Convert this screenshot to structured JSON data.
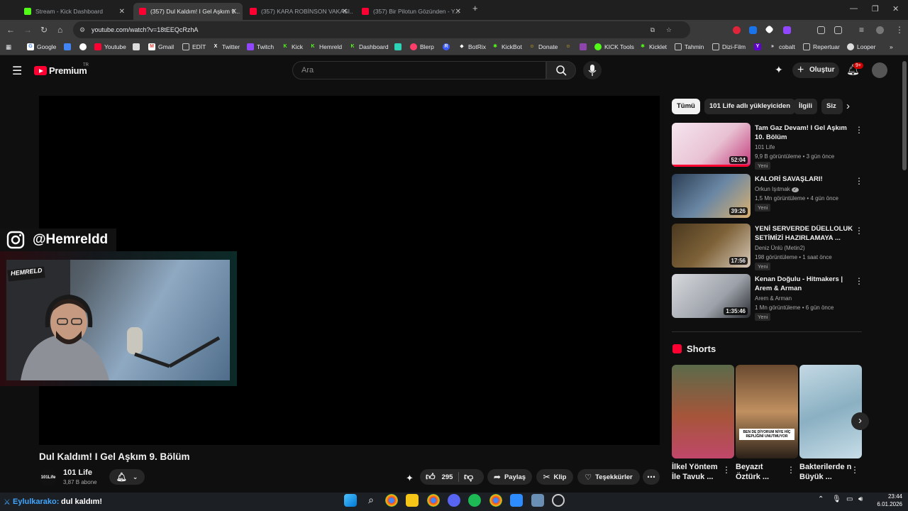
{
  "browser": {
    "tabs": [
      {
        "label": "Stream - Kick Dashboard",
        "active": false
      },
      {
        "label": "(357) Dul Kaldım! I Gel Aşkım 9...",
        "active": true
      },
      {
        "label": "(357) KARA ROBİNSON VAKASI...",
        "active": false
      },
      {
        "label": "(357) Bir Pilotun Gözünden - Y...",
        "active": false
      }
    ],
    "url": "youtube.com/watch?v=18tEEQcRzhA",
    "bookmarks": [
      "Google",
      "Youtube",
      "Gmail",
      "EDİT",
      "Twitter",
      "Twitch",
      "Kick",
      "Hemreld",
      "Dashboard",
      "Blerp",
      "BotRix",
      "KickBot",
      "Donate",
      "KICK Tools",
      "Kicklet",
      "Tahmin",
      "Dizi-Film",
      "cobalt",
      "Repertuar",
      "Looper"
    ]
  },
  "masthead": {
    "logo_text": "Premium",
    "logo_region": "TR",
    "search_placeholder": "Ara",
    "create_label": "Oluştur",
    "notif_count": "9+"
  },
  "overlay": {
    "ig_handle": "@Hemreldd",
    "cam_logo": "HEMRELD"
  },
  "video": {
    "title": "Dul Kaldım! I Gel Aşkım 9. Bölüm",
    "channel": "101 Life",
    "subscribers": "3,87 B abone",
    "avatar_text": "101Life",
    "likes": "295",
    "share_label": "Paylaş",
    "clip_label": "Klip",
    "thanks_label": "Teşekkürler"
  },
  "chips": [
    "Tümü",
    "101 Life adlı yükleyiciden",
    "İlgili",
    "Siz"
  ],
  "recommendations": [
    {
      "title": "Tam Gaz Devam! I Gel Aşkım 10. Bölüm",
      "channel": "101 Life",
      "meta": "9,9 B görüntüleme • 3 gün önce",
      "badge": "Yeni",
      "duration": "52:04",
      "thumb_color": "#c23a7a"
    },
    {
      "title": "KALORİ SAVAŞLARI!",
      "channel": "Orkun Işıtmak",
      "verified": true,
      "meta": "1,5 Mn görüntüleme • 4 gün önce",
      "badge": "Yeni",
      "duration": "39:26",
      "thumb_color": "#4a6a8a"
    },
    {
      "title": "YENİ SERVERDE DÜELLOLUK SETİMİZİ HAZIRLAMAYA ...",
      "channel": "Deniz Ünlü (Metin2)",
      "meta": "198 görüntüleme • 1 saat önce",
      "badge": "Yeni",
      "duration": "17:56",
      "thumb_color": "#6b4a2a"
    },
    {
      "title": "Kenan Doğulu - Hitmakers | Arem & Arman",
      "channel": "Arem & Arman",
      "meta": "1 Mn görüntüleme • 6 gün önce",
      "badge": "Yeni",
      "duration": "1:35:46",
      "thumb_color": "#b9bcc2"
    }
  ],
  "shorts": {
    "heading": "Shorts",
    "items": [
      {
        "title": "İlkel Yöntem İle Tavuk ...",
        "thumb_color": "#7a3a4a"
      },
      {
        "title": "Beyazıt Öztürk ...",
        "thumb_color": "#8a6a4a",
        "caption": "BEN DE DİYORUM NİYE HİÇ REPLİĞİNİ UNUTMUYOR"
      },
      {
        "title": "Bakterilerde n Büyük ...",
        "thumb_color": "#9ab8c8"
      }
    ]
  },
  "chat": {
    "user": "Eylulkarako:",
    "message": "dul kaldım!"
  },
  "clock": {
    "time": "23:44",
    "date": "6.01.2026"
  }
}
